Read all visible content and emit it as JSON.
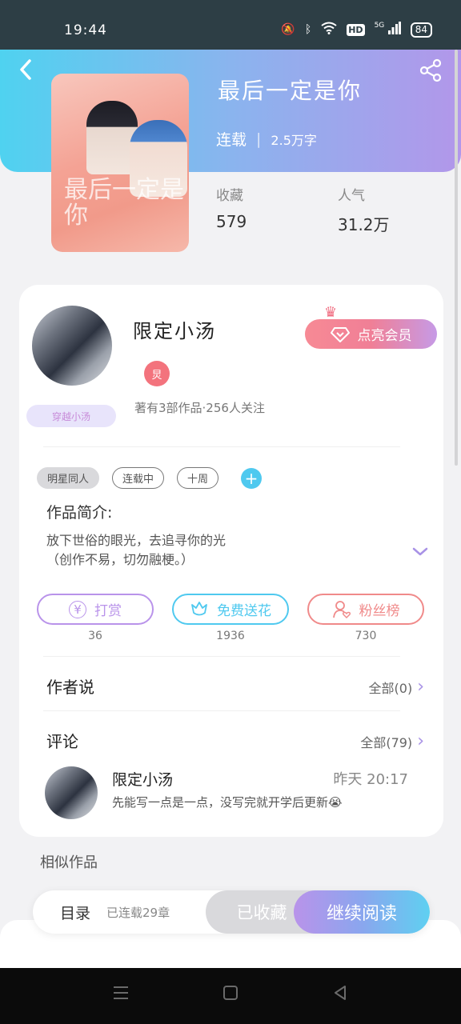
{
  "status_bar": {
    "time": "19:44",
    "signal": "5G",
    "battery": "84"
  },
  "header": {
    "back_icon": "chevron-left-icon",
    "share_icon": "share-icon"
  },
  "book": {
    "cover_text": "最后一定是你",
    "title": "最后一定是你",
    "status": "连载",
    "word_count": "2.5万字",
    "favorites_label": "收藏",
    "favorites_value": "579",
    "popularity_label": "人气",
    "popularity_value": "31.2万"
  },
  "author": {
    "name": "限定小汤",
    "level_badge": "炅",
    "fan_badge": "穿越小汤",
    "stats": "著有3部作品·256人关注",
    "vip_button": "点亮会员"
  },
  "tags": [
    "明星同人",
    "连载中",
    "十周"
  ],
  "intro": {
    "title": "作品简介:",
    "line1": "放下世俗的眼光，去追寻你的光",
    "line2": "（创作不易，切勿融梗。）"
  },
  "actions": [
    {
      "label": "打赏",
      "count": "36",
      "icon": "yen-icon",
      "color": "#b993ea"
    },
    {
      "label": "免费送花",
      "count": "1936",
      "icon": "flower-icon",
      "color": "#4fc9ef"
    },
    {
      "label": "粉丝榜",
      "count": "730",
      "icon": "fan-icon",
      "color": "#f08a8a"
    }
  ],
  "author_says": {
    "title": "作者说",
    "more": "全部(0)"
  },
  "comments": {
    "title": "评论",
    "more": "全部(79)",
    "items": [
      {
        "name": "限定小汤",
        "time": "昨天 20:17",
        "text": "先能写一点是一点，没写完就开学后更新😭"
      }
    ]
  },
  "similar": {
    "title": "相似作品"
  },
  "bottom_bar": {
    "toc": "目录",
    "serial": "已连载29章",
    "collected": "已收藏",
    "continue": "继续阅读"
  },
  "nav": {
    "menu_icon": "menu-icon",
    "home_icon": "home-icon",
    "back_icon": "back-triangle-icon"
  }
}
